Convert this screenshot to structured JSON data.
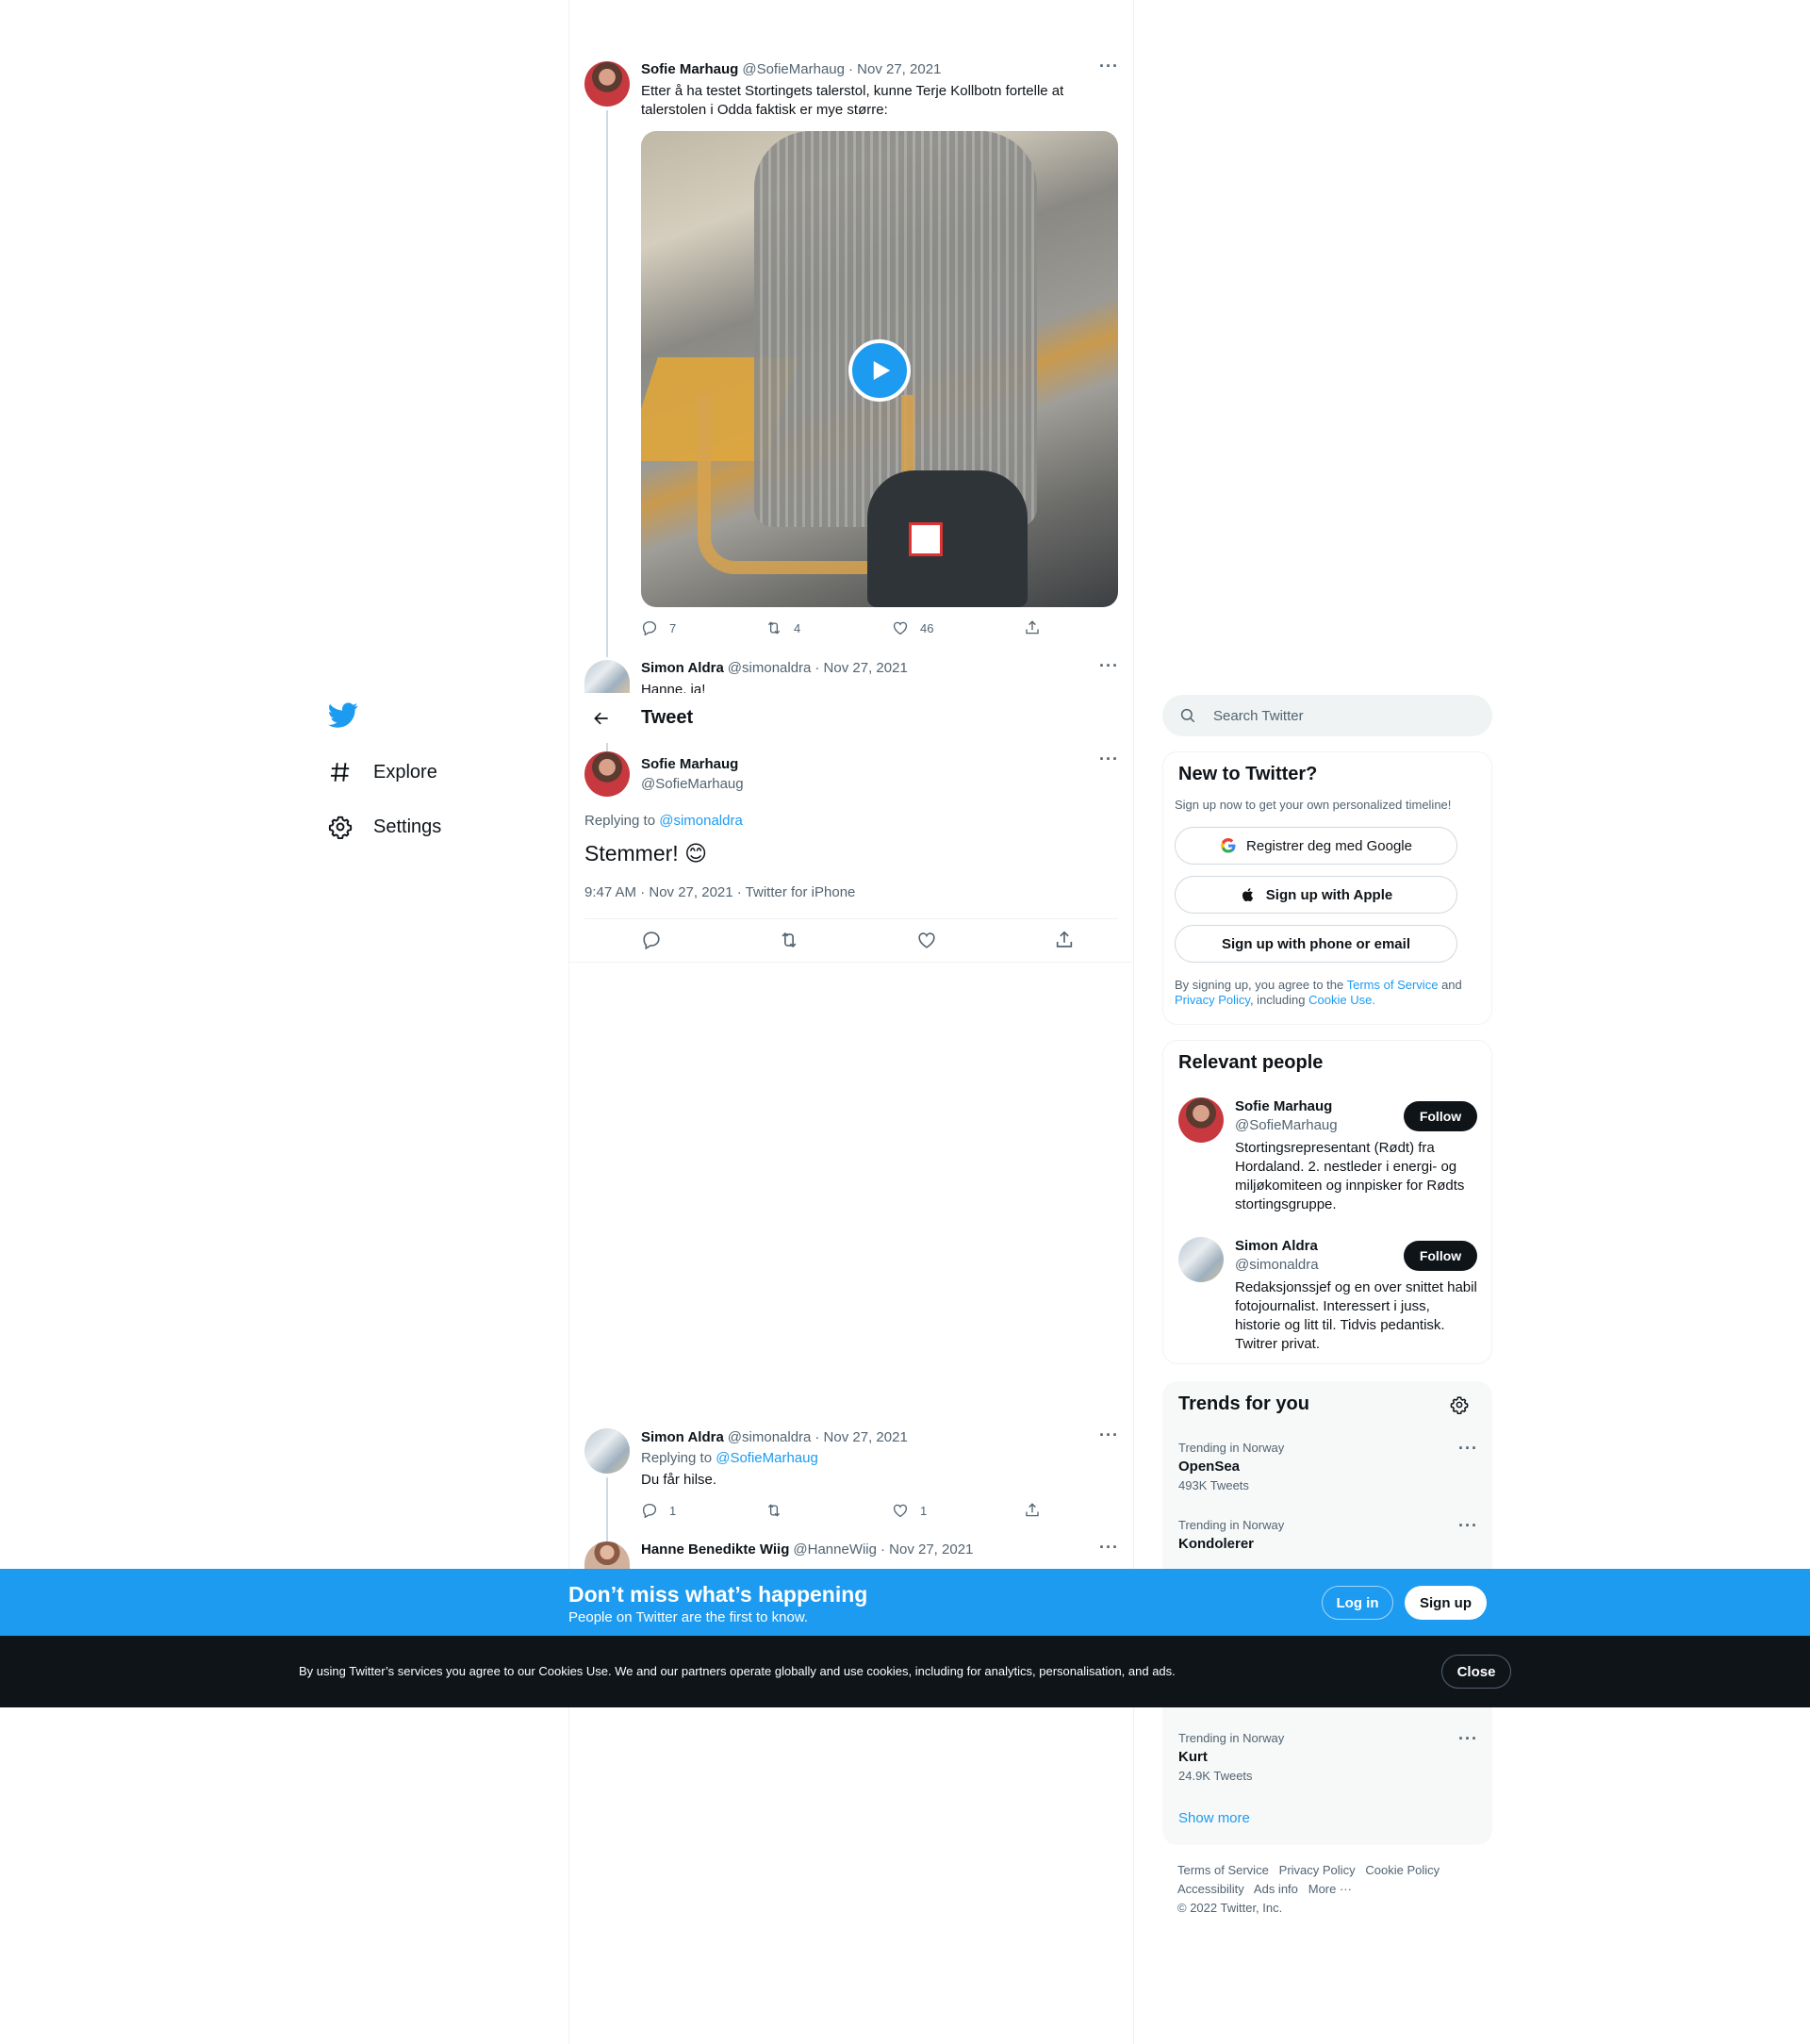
{
  "nav": {
    "explore_label": "Explore",
    "settings_label": "Settings"
  },
  "thread_tweet_1": {
    "name": "Sofie Marhaug",
    "handle": "@SofieMarhaug",
    "date": "· Nov 27, 2021",
    "text_line1": "Etter å ha testet Stortingets talerstol, kunne Terje Kollbotn fortelle at",
    "text_line2": "talerstolen i Odda faktisk er mye større:",
    "replies": "7",
    "retweets": "4",
    "likes": "46"
  },
  "thread_tweet_2": {
    "name": "Simon Aldra",
    "handle": "@simonaldra",
    "date": "· Nov 27, 2021",
    "text": "Hanne, ja!"
  },
  "header": {
    "title": "Tweet"
  },
  "main_tweet": {
    "name": "Sofie Marhaug",
    "handle": "@SofieMarhaug",
    "replying_prefix": "Replying to",
    "replying_to": "@simonaldra",
    "text": "Stemmer! 😊",
    "meta": "9:47 AM · Nov 27, 2021 · Twitter for iPhone"
  },
  "reply_1": {
    "name": "Simon Aldra",
    "handle": "@simonaldra",
    "date": "· Nov 27, 2021",
    "replying_prefix": "Replying to",
    "replying_to": "@SofieMarhaug",
    "text": "Du får hilse.",
    "replies": "1",
    "likes": "1"
  },
  "reply_2": {
    "name": "Hanne Benedikte Wiig",
    "handle": "@HanneWiig",
    "date": "· Nov 27, 2021"
  },
  "search": {
    "placeholder": "Search Twitter"
  },
  "new_to_twitter": {
    "title": "New to Twitter?",
    "subtitle": "Sign up now to get your own personalized timeline!",
    "google_label": "Registrer deg med Google",
    "apple_label": "Sign up with Apple",
    "phone_label": "Sign up with phone or email",
    "legal_1": "By signing up, you agree to the",
    "terms": "Terms of Service",
    "and": "and",
    "privacy": "Privacy Policy",
    "including": ", including",
    "cookie": "Cookie Use."
  },
  "relevant_people": {
    "title": "Relevant people",
    "people": [
      {
        "name": "Sofie Marhaug",
        "handle": "@SofieMarhaug",
        "follow": "Follow",
        "bio": [
          "Stortingsrepresentant (Rødt) fra",
          "Hordaland. 2. nestleder i energi- og",
          "miljøkomiteen og innpisker for Rødts",
          "stortingsgruppe."
        ]
      },
      {
        "name": "Simon Aldra",
        "handle": "@simonaldra",
        "follow": "Follow",
        "bio": [
          "Redaksjonssjef og en over snittet habil",
          "fotojournalist. Interessert i juss,",
          "historie og litt til. Tidvis pedantisk.",
          "Twitrer privat."
        ]
      }
    ]
  },
  "trends": {
    "title": "Trends for you",
    "items": [
      {
        "context": "Trending in Norway",
        "name": "OpenSea",
        "count": "493K Tweets"
      },
      {
        "context": "Trending in Norway",
        "name": "Kondolerer",
        "count": ""
      },
      {
        "context": "Trending in Norway",
        "name": "Kurt",
        "count": "24.9K Tweets"
      }
    ],
    "show_more": "Show more"
  },
  "footer": {
    "terms": "Terms of Service",
    "privacy": "Privacy Policy",
    "cookie": "Cookie Policy",
    "accessibility": "Accessibility",
    "ads": "Ads info",
    "more": "More ···",
    "copyright": "© 2022 Twitter, Inc."
  },
  "dont_miss": {
    "title": "Don’t miss what’s happening",
    "subtitle": "People on Twitter are the first to know.",
    "login": "Log in",
    "signup": "Sign up"
  },
  "cookie_bar": {
    "text": "By using Twitter’s services you agree to our Cookies Use. We and our partners operate globally and use cookies, including for analytics, personalisation, and ads.",
    "close": "Close"
  },
  "colors": {
    "accent": "#1d9bf0",
    "dark": "#0f1419",
    "muted": "#536471"
  }
}
